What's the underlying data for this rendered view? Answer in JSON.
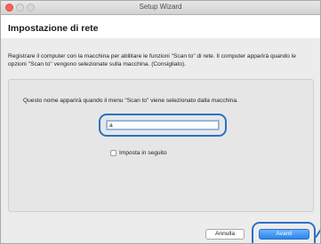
{
  "window": {
    "title": "Setup Wizard"
  },
  "header": {
    "heading": "Impostazione di rete"
  },
  "main": {
    "description": "Registrare il computer con la macchina per abilitare le funzioni \"Scan to\" di rete. Il computer apparirà quando le opzioni \"Scan to\" vengono selezionate sulla macchina. (Consigliato).",
    "prompt": "Questo nome apparirà quando il menu \"Scan to\" viene selezionato dalla macchina.",
    "name_value": "a",
    "later_label": "Imposta in seguito"
  },
  "buttons": {
    "cancel_label": "Annulla",
    "next_label": "Avanti"
  },
  "colors": {
    "highlight": "#2a72c3",
    "primary_button": "#2b84ee"
  }
}
